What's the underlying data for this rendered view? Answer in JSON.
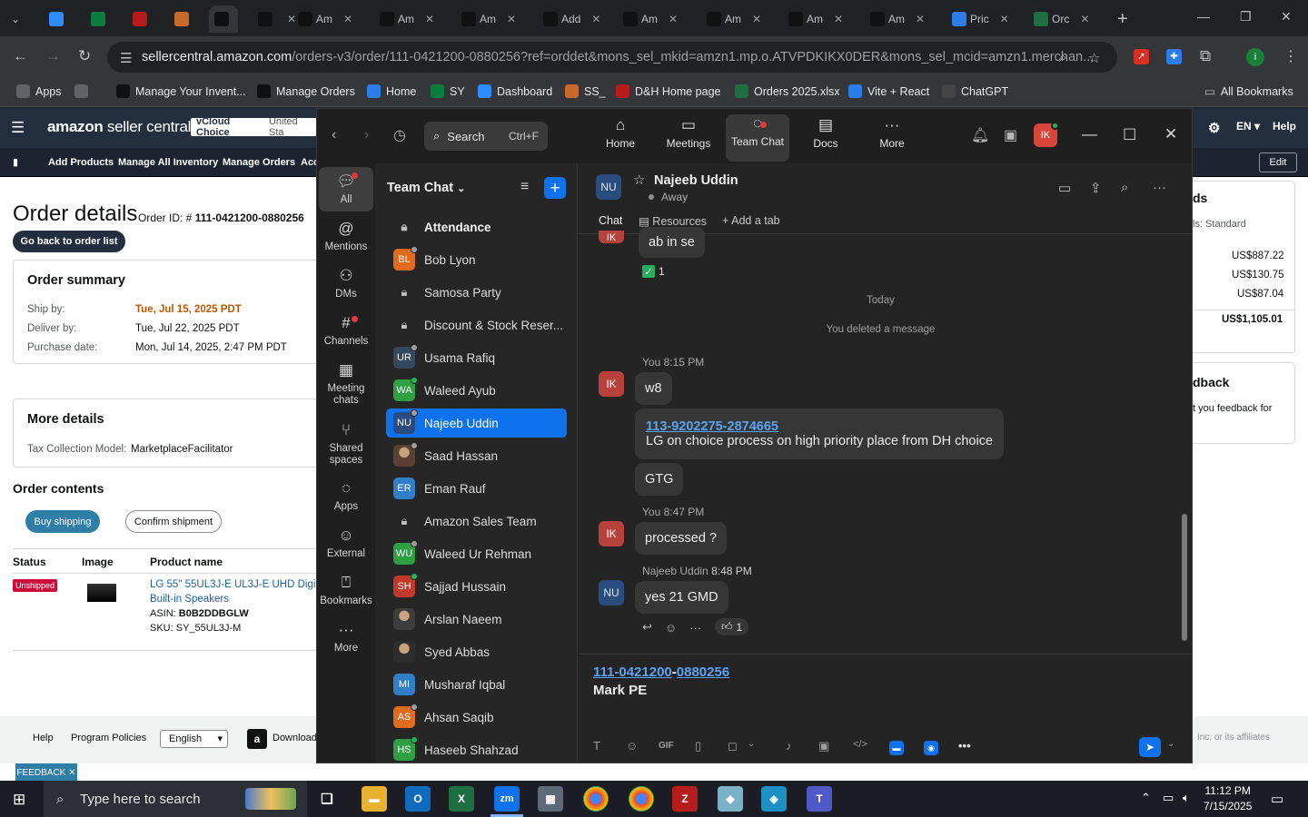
{
  "browser": {
    "tabs": [
      {
        "label": "",
        "icon": "zoom-icon",
        "color": "#2d8cff"
      },
      {
        "label": "",
        "icon": "ec-icon",
        "color": "#0a7c3e"
      },
      {
        "label": "",
        "icon": "dh-icon",
        "color": "#b71c1c"
      },
      {
        "label": "",
        "icon": "box-icon",
        "color": "#c86b2a"
      },
      {
        "label": "",
        "icon": "amazon-icon",
        "color": "#111"
      },
      {
        "label": "",
        "icon": "amazon-icon",
        "color": "#111"
      },
      {
        "label": "Am",
        "icon": "amazon-icon",
        "color": "#111"
      },
      {
        "label": "Am",
        "icon": "amazon-icon",
        "color": "#111"
      },
      {
        "label": "Am",
        "icon": "amazon-icon",
        "color": "#111"
      },
      {
        "label": "Add",
        "icon": "amazon-icon",
        "color": "#111"
      },
      {
        "label": "Am",
        "icon": "amazon-icon",
        "color": "#111"
      },
      {
        "label": "Am",
        "icon": "amazon-icon",
        "color": "#111"
      },
      {
        "label": "Am",
        "icon": "amazon-icon",
        "color": "#111"
      },
      {
        "label": "Am",
        "icon": "amazon-icon",
        "color": "#111"
      },
      {
        "label": "Pric",
        "icon": "dollar-icon",
        "color": "#2b7de9"
      },
      {
        "label": "Orc",
        "icon": "excel-icon",
        "color": "#1d6f42"
      }
    ],
    "url_host": "sellercentral.amazon.com",
    "url_rest": "/orders-v3/order/111-0421200-0880256?ref=orddet&mons_sel_mkid=amzn1.mp.o.ATVPDKIKX0DER&mons_sel_mcid=amzn1.merchan...",
    "bookmarks": [
      {
        "label": "Apps",
        "icon": "grid-icon",
        "color": "#5f6368"
      },
      {
        "label": "",
        "icon": "apps-grid-icon",
        "color": "#5f6368"
      },
      {
        "label": "Manage Your Invent...",
        "icon": "amazon-icon",
        "color": "#111"
      },
      {
        "label": "Manage Orders",
        "icon": "amazon-icon",
        "color": "#111"
      },
      {
        "label": "Home",
        "icon": "home-flag-icon",
        "color": "#2b7de9"
      },
      {
        "label": "SY",
        "icon": "ec-icon",
        "color": "#0a7c3e"
      },
      {
        "label": "Dashboard",
        "icon": "dashboard-icon",
        "color": "#2d8cff"
      },
      {
        "label": "SS_",
        "icon": "ss-icon",
        "color": "#c86b2a"
      },
      {
        "label": "D&H Home page",
        "icon": "dh-icon",
        "color": "#b71c1c"
      },
      {
        "label": "Orders 2025.xlsx",
        "icon": "excel-icon",
        "color": "#1d6f42"
      },
      {
        "label": "Vite + React",
        "icon": "dollar-icon",
        "color": "#2b7de9"
      },
      {
        "label": "ChatGPT",
        "icon": "chatgpt-icon",
        "color": "#444"
      }
    ],
    "all_bookmarks": "All Bookmarks"
  },
  "seller": {
    "logo_main": "amazon",
    "logo_sub": " seller central",
    "vcloud": "vCloud Choice",
    "vcloud_region": "United Sta",
    "sub_nav": [
      "Add Products",
      "Manage All Inventory",
      "Manage Orders",
      "Acc"
    ],
    "lang": "EN",
    "help": "Help",
    "edit": "Edit",
    "title": "Order details",
    "order_id_label": "Order ID: # ",
    "order_id": "111-0421200-0880256",
    "back": "Go back to order list",
    "summary_title": "Order summary",
    "ship_by_label": "Ship by:",
    "ship_by": "Tue, Jul 15, 2025 PDT",
    "deliver_by_label": "Deliver by:",
    "deliver_by": "Tue, Jul 22, 2025 PDT",
    "purchase_label": "Purchase date:",
    "purchase": "Mon, Jul 14, 2025, 2:47 PM PDT",
    "more_title": "More details",
    "tax_label": "Tax Collection Model:",
    "tax_value": "MarketplaceFacilitator",
    "contents_title": "Order contents",
    "buy_shipping": "Buy shipping",
    "confirm_shipment": "Confirm shipment",
    "col_status": "Status",
    "col_image": "Image",
    "col_product": "Product name",
    "status_badge": "Unshipped",
    "product_line1": "LG 55\" 55UL3J-E UL3J-E UHD Digita",
    "product_line2": "Built-in Speakers",
    "asin_label": "ASIN: ",
    "asin": "B0B2DDBGLW",
    "sku_label": "SKU: ",
    "sku": "SY_55UL3J-M",
    "footer_help": "Help",
    "footer_policies": "Program Policies",
    "footer_lang": "English",
    "footer_download": "Download",
    "footer_copyright": "Inc. or its affiliates",
    "feedback": "FEEDBACK",
    "right_ds": "ds",
    "right_standard": "ls: Standard",
    "amounts": [
      "US$887.22",
      "US$130.75",
      "US$87.04",
      "US$1,105.01"
    ],
    "right_feedback": "dback",
    "right_feedback_text": "t you feedback for"
  },
  "zoom": {
    "search_label": "Search",
    "search_shortcut": "Ctrl+F",
    "tabs": [
      {
        "label": "Home",
        "icon": "home-icon"
      },
      {
        "label": "Meetings",
        "icon": "camera-icon"
      },
      {
        "label": "Team Chat",
        "icon": "chat-bubbles-icon"
      },
      {
        "label": "Docs",
        "icon": "doc-icon"
      },
      {
        "label": "More",
        "icon": "more-dots-icon"
      }
    ],
    "user_initials": "IK",
    "rail": [
      {
        "label": "All",
        "icon": "chat-icon"
      },
      {
        "label": "Mentions",
        "icon": "at-icon"
      },
      {
        "label": "DMs",
        "icon": "people-icon"
      },
      {
        "label": "Channels",
        "icon": "hash-icon"
      },
      {
        "label": "Meeting chats",
        "icon": "calendar-icon"
      },
      {
        "label": "Shared spaces",
        "icon": "share-icon"
      },
      {
        "label": "Apps",
        "icon": "apps-chat-icon"
      },
      {
        "label": "External",
        "icon": "external-user-icon"
      },
      {
        "label": "Bookmarks",
        "icon": "bookmark-icon"
      },
      {
        "label": "More",
        "icon": "more-dots-icon"
      }
    ],
    "list_title": "Team Chat",
    "contacts": [
      {
        "name": "Attendance",
        "initials": "",
        "kind": "lock",
        "color": "",
        "status": ""
      },
      {
        "name": "Bob Lyon",
        "initials": "BL",
        "kind": "avatar",
        "color": "#e06b1d",
        "status": "#9e9e9e"
      },
      {
        "name": "Samosa Party",
        "initials": "",
        "kind": "lock",
        "color": "",
        "status": ""
      },
      {
        "name": "Discount & Stock Reser...",
        "initials": "",
        "kind": "lock",
        "color": "",
        "status": ""
      },
      {
        "name": "Usama Rafiq",
        "initials": "UR",
        "kind": "avatar",
        "color": "#34495e",
        "status": "#9e9e9e"
      },
      {
        "name": "Waleed Ayub",
        "initials": "WA",
        "kind": "avatar",
        "color": "#2ea043",
        "status": "#1db954"
      },
      {
        "name": "Najeeb Uddin",
        "initials": "NU",
        "kind": "avatar",
        "color": "#2b4c7e",
        "status": "#9e9e9e"
      },
      {
        "name": "Saad Hassan",
        "initials": "",
        "kind": "photo",
        "color": "#5a4030",
        "status": "#9e9e9e"
      },
      {
        "name": "Eman Rauf",
        "initials": "ER",
        "kind": "avatar",
        "color": "#2f7ec7",
        "status": ""
      },
      {
        "name": "Amazon Sales Team",
        "initials": "",
        "kind": "lock",
        "color": "",
        "status": ""
      },
      {
        "name": "Waleed Ur Rehman",
        "initials": "WU",
        "kind": "avatar",
        "color": "#2ea043",
        "status": "#9e9e9e"
      },
      {
        "name": "Sajjad Hussain",
        "initials": "SH",
        "kind": "avatar",
        "color": "#c0392b",
        "status": "#1db954"
      },
      {
        "name": "Arslan Naeem",
        "initials": "",
        "kind": "photo",
        "color": "#3d3d3d",
        "status": ""
      },
      {
        "name": "Syed Abbas",
        "initials": "",
        "kind": "photo",
        "color": "#2d2d2d",
        "status": ""
      },
      {
        "name": "Musharaf Iqbal",
        "initials": "MI",
        "kind": "avatar",
        "color": "#2f7ec7",
        "status": ""
      },
      {
        "name": "Ahsan Saqib",
        "initials": "AS",
        "kind": "avatar",
        "color": "#e06b1d",
        "status": "#9e9e9e"
      },
      {
        "name": "Haseeb Shahzad",
        "initials": "HS",
        "kind": "avatar",
        "color": "#2ea043",
        "status": "#1db954"
      }
    ],
    "chat": {
      "initials": "NU",
      "name": "Najeeb Uddin",
      "status": "Away",
      "tab_chat": "Chat",
      "tab_resources": "Resources",
      "tab_add": "Add a tab",
      "prev_bubble": "ab in se",
      "prev_reaction_count": "1",
      "day_divider": "Today",
      "deleted": "You deleted a message",
      "messages": [
        {
          "meta": "You 8:15 PM",
          "avatar": "IK"
        },
        {
          "text": "w8"
        },
        {
          "link": "113-9202275-2874665",
          "text": "LG on choice process on high priority   place from DH choice"
        },
        {
          "text": "GTG"
        },
        {
          "meta": "You 8:47 PM",
          "avatar": "IK"
        },
        {
          "text": "processed ?"
        },
        {
          "meta_name": "Najeeb Uddin",
          "meta_time": "8:48 PM",
          "avatar": "NU"
        },
        {
          "text": "yes 21 GMD",
          "reaction_count": "1"
        }
      ],
      "prev_avatar": "IK"
    },
    "composer": {
      "link_a": "111-0421200",
      "sep": "-",
      "link_b": "0880256",
      "text": "Mark PE",
      "gif": "GIF"
    }
  },
  "taskbar": {
    "search": "Type here to search",
    "time": "11:12 PM",
    "date": "7/15/2025"
  },
  "colors": {
    "zoom_blue": "#0e72ed",
    "amazon_nav": "#232f3e",
    "unshipped_red": "#cc0c39"
  }
}
